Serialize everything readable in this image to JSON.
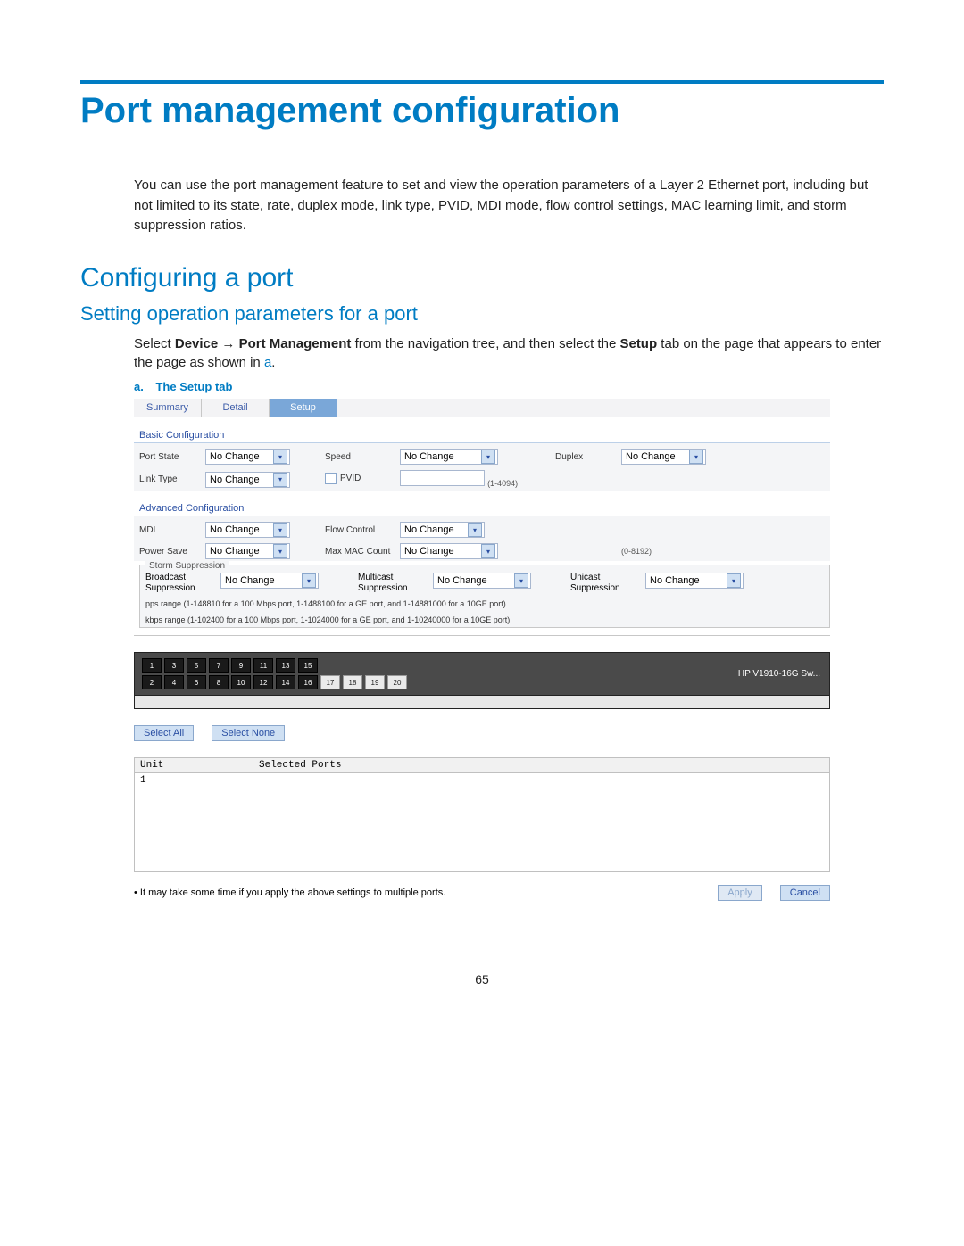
{
  "doc": {
    "title": "Port management configuration",
    "intro": "You can use the port management feature to set and view the operation parameters of a Layer 2 Ethernet port, including but not limited to its state, rate, duplex mode, link type, PVID, MDI mode, flow control settings, MAC learning limit, and storm suppression ratios.",
    "h2": "Configuring a port",
    "h3": "Setting operation parameters for a port",
    "body_pre": "Select ",
    "body_bold_1": "Device",
    "body_arrow": " → ",
    "body_bold_2": "Port Management",
    "body_mid": " from the navigation tree, and then select the ",
    "body_bold_3": "Setup",
    "body_post": " tab on the page that appears to enter the page as shown in ",
    "body_link": "a",
    "body_end": ".",
    "caption_letter": "a.",
    "caption_pre": "The ",
    "caption_bold": "Setup",
    "caption_post": " tab",
    "page_num": "65"
  },
  "tabs": [
    "Summary",
    "Detail",
    "Setup"
  ],
  "active_tab": 2,
  "basic": {
    "title": "Basic Configuration",
    "rows": {
      "port_state": {
        "label": "Port State",
        "value": "No Change"
      },
      "speed": {
        "label": "Speed",
        "value": "No Change"
      },
      "duplex": {
        "label": "Duplex",
        "value": "No Change"
      },
      "link_type": {
        "label": "Link Type",
        "value": "No Change"
      },
      "pvid": {
        "label": "PVID",
        "hint": "(1-4094)"
      }
    }
  },
  "advanced": {
    "title": "Advanced Configuration",
    "rows": {
      "mdi": {
        "label": "MDI",
        "value": "No Change"
      },
      "flow": {
        "label": "Flow Control",
        "value": "No Change"
      },
      "power": {
        "label": "Power Save",
        "value": "No Change"
      },
      "maxmac": {
        "label": "Max MAC Count",
        "value": "No Change",
        "hint": "(0-8192)"
      }
    }
  },
  "storm": {
    "legend": "Storm Suppression",
    "bcast": {
      "label": "Broadcast Suppression",
      "value": "No Change"
    },
    "mcast": {
      "label": "Multicast Suppression",
      "value": "No Change"
    },
    "ucast": {
      "label": "Unicast Suppression",
      "value": "No Change"
    },
    "note1": "pps range (1-148810 for a 100 Mbps port, 1-1488100 for a GE port, and 1-14881000 for a 10GE port)",
    "note2": "kbps range (1-102400 for a 100 Mbps port, 1-1024000 for a GE port, and 1-10240000 for a 10GE port)"
  },
  "switch": {
    "name": "HP V1910-16G Sw...",
    "ports_top": [
      "1",
      "3",
      "5",
      "7",
      "9",
      "11",
      "13",
      "15"
    ],
    "ports_bottom": [
      "2",
      "4",
      "6",
      "8",
      "10",
      "12",
      "14",
      "16",
      "17",
      "18",
      "19",
      "20"
    ]
  },
  "buttons": {
    "select_all": "Select All",
    "select_none": "Select None",
    "apply": "Apply",
    "cancel": "Cancel"
  },
  "selected_ports": {
    "h_unit": "Unit",
    "h_sel": "Selected Ports",
    "unit_val": "1"
  },
  "note": "It may take some time if you apply the above settings to multiple ports."
}
